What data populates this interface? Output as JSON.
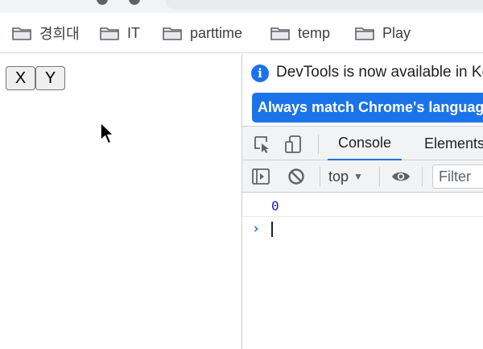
{
  "bookmarks": [
    {
      "label": "경희대",
      "icon": "folder-icon"
    },
    {
      "label": "IT",
      "icon": "folder-icon"
    },
    {
      "label": "parttime",
      "icon": "folder-icon"
    },
    {
      "label": "temp",
      "icon": "folder-icon"
    },
    {
      "label": "Play",
      "icon": "folder-icon"
    }
  ],
  "page": {
    "buttons": {
      "x": "X",
      "y": "Y"
    }
  },
  "devtools": {
    "info_icon_glyph": "i",
    "info_text": "DevTools is now available in Ko",
    "match_button": "Always match Chrome's language",
    "tabs": {
      "console": "Console",
      "elements": "Elements"
    },
    "context": "top",
    "filter_placeholder": "Filter",
    "log_value": "0",
    "prompt": "›"
  },
  "colors": {
    "accent": "#1a73e8",
    "log_number": "#1a1aa6"
  }
}
